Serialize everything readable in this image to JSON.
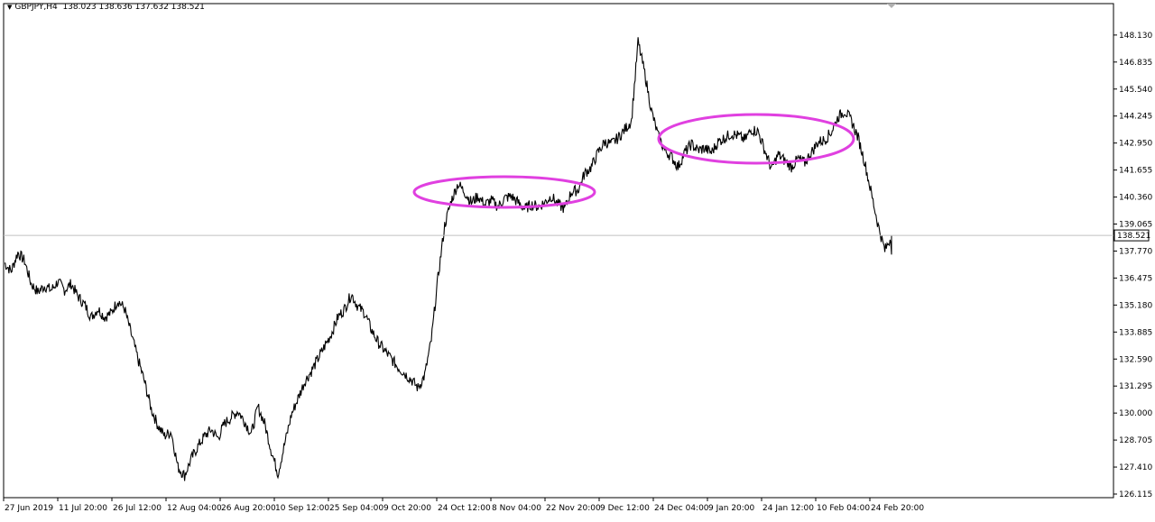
{
  "header": {
    "symbol_timeframe": "GBPJPY,H4",
    "ohlc": "138.023 138.636 137.632 138.521"
  },
  "chart_data": {
    "type": "line",
    "y_ticks": [
      "148.130",
      "146.835",
      "145.540",
      "144.245",
      "142.950",
      "141.655",
      "140.360",
      "139.065",
      "137.770",
      "136.475",
      "135.180",
      "133.885",
      "132.590",
      "131.295",
      "130.000",
      "128.705",
      "127.410",
      "126.115"
    ],
    "ylim": [
      126.115,
      148.6
    ],
    "x_tick_labels": [
      "27 Jun 2019",
      "11 Jul 20:00",
      "26 Jul 12:00",
      "12 Aug 04:00",
      "26 Aug 20:00",
      "10 Sep 12:00",
      "25 Sep 04:00",
      "9 Oct 20:00",
      "24 Oct 12:00",
      "8 Nov 04:00",
      "22 Nov 20:00",
      "9 Dec 12:00",
      "24 Dec 04:00",
      "9 Jan 20:00",
      "24 Jan 12:00",
      "10 Feb 04:00",
      "24 Feb 20:00"
    ],
    "current_price": "138.521",
    "series": [
      {
        "values": [
          137.2,
          136.8,
          137.7,
          137.3,
          136.2,
          135.8,
          136.1,
          135.9,
          136.3,
          135.9,
          136.2,
          135.6,
          135.2,
          134.6,
          135.0,
          134.6,
          134.8,
          135.4,
          135.0,
          133.8,
          132.6,
          131.5,
          130.2,
          129.4,
          128.9,
          129.1,
          127.4,
          127.0,
          127.8,
          128.4,
          128.9,
          129.2,
          128.8,
          129.5,
          129.8,
          130.1,
          129.6,
          129.0,
          130.3,
          129.5,
          128.2,
          127.1,
          128.5,
          129.9,
          130.7,
          131.5,
          132.0,
          132.6,
          133.2,
          133.8,
          134.6,
          135.0,
          135.7,
          135.1,
          134.8,
          134.0,
          133.4,
          133.0,
          132.6,
          132.2,
          131.9,
          131.6,
          131.2,
          131.8,
          133.5,
          136.5,
          139.0,
          140.2,
          141.0,
          140.6,
          140.1,
          140.4,
          140.0,
          140.2,
          139.9,
          140.3,
          140.4,
          140.1,
          139.8,
          140.0,
          139.9,
          140.1,
          140.4,
          140.0,
          139.8,
          140.6,
          140.7,
          141.5,
          141.8,
          142.5,
          143.0,
          142.9,
          143.2,
          143.6,
          144.0,
          147.8,
          146.3,
          144.5,
          143.3,
          142.6,
          142.3,
          141.8,
          142.5,
          142.9,
          142.6,
          142.7,
          142.5,
          143.0,
          143.2,
          143.4,
          143.3,
          143.1,
          143.6,
          143.5,
          142.6,
          141.7,
          142.4,
          142.1,
          141.8,
          142.2,
          142.0,
          142.5,
          143.0,
          143.1,
          143.5,
          144.2,
          144.5,
          144.0,
          143.2,
          142.0,
          140.5,
          139.0,
          137.8,
          138.5
        ]
      }
    ],
    "highlight_ellipses": 2,
    "grid": false
  }
}
